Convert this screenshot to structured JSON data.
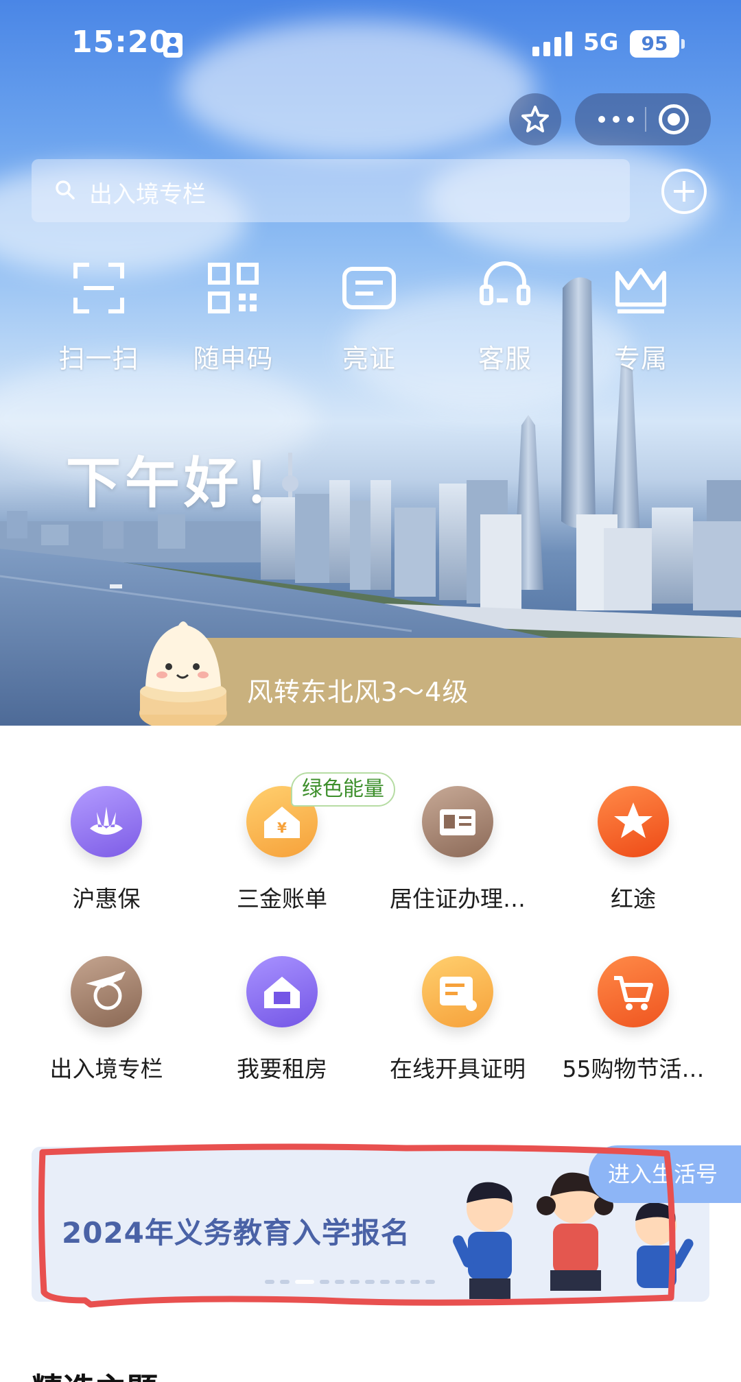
{
  "status_bar": {
    "time": "15:20",
    "network": "5G",
    "battery": "95"
  },
  "search": {
    "placeholder": "出入境专栏"
  },
  "quick_actions": [
    {
      "label": "扫一扫",
      "icon": "scan-icon"
    },
    {
      "label": "随申码",
      "icon": "qr-code-icon"
    },
    {
      "label": "亮证",
      "icon": "card-icon"
    },
    {
      "label": "客服",
      "icon": "headset-icon"
    },
    {
      "label": "专属",
      "icon": "crown-icon"
    }
  ],
  "greeting": "下午好！",
  "weather": {
    "text": "风转东北风3～4级"
  },
  "services": [
    {
      "label": "沪惠保",
      "icon": "lotus-icon",
      "color": "#9c7ef0"
    },
    {
      "label": "三金账单",
      "icon": "house-yuan-icon",
      "color": "#fbb04a"
    },
    {
      "label": "居住证办理…",
      "icon": "residence-card-icon",
      "color": "#a98773"
    },
    {
      "label": "红途",
      "icon": "red-star-icon",
      "color": "#f5622a"
    },
    {
      "label": "出入境专栏",
      "icon": "airplane-globe-icon",
      "color": "#a47e68"
    },
    {
      "label": "我要租房",
      "icon": "rent-house-icon",
      "color": "#8a73ee"
    },
    {
      "label": "在线开具证明",
      "icon": "certificate-icon",
      "color": "#fbb04a"
    },
    {
      "label": "55购物节活…",
      "icon": "shopping-cart-icon",
      "color": "#f5662f"
    }
  ],
  "green_tag": "绿色能量",
  "banner": {
    "title": "2024年义务教育入学报名",
    "link": "进入生活号"
  },
  "section": {
    "title": "精选主题"
  }
}
